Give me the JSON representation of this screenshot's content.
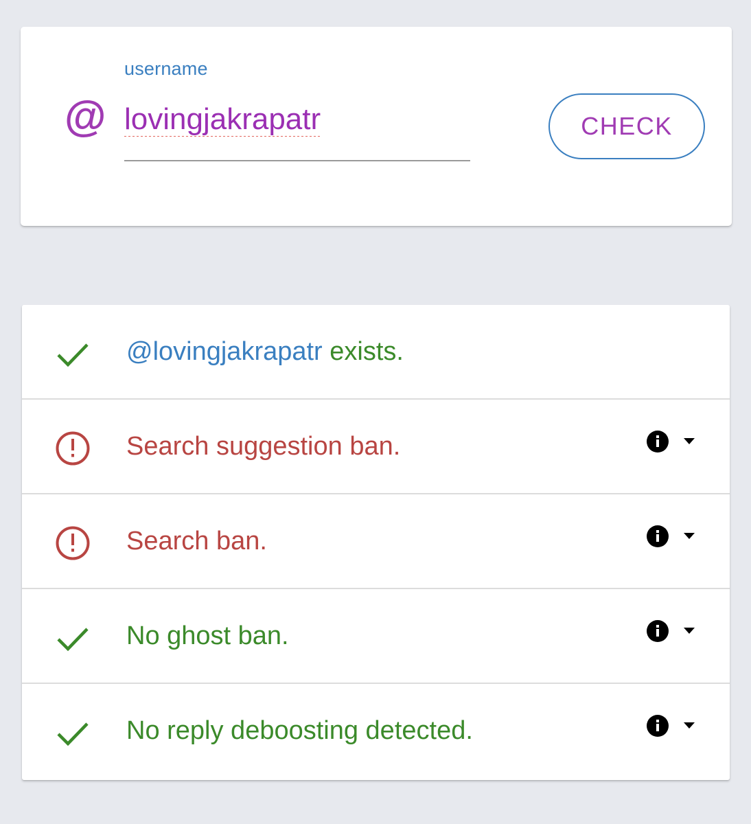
{
  "form": {
    "field_label": "username",
    "at_symbol": "@",
    "username_value": "lovingjakrapatr",
    "check_label": "CHECK"
  },
  "results": [
    {
      "status": "ok",
      "icon": "check-icon",
      "handle": "@lovingjakrapatr",
      "text": " exists.",
      "has_details": false
    },
    {
      "status": "ban",
      "icon": "alert-circle-icon",
      "text": "Search suggestion ban.",
      "has_details": true
    },
    {
      "status": "ban",
      "icon": "alert-circle-icon",
      "text": "Search ban.",
      "has_details": true
    },
    {
      "status": "ok",
      "icon": "check-icon",
      "text": "No ghost ban.",
      "has_details": true
    },
    {
      "status": "ok",
      "icon": "check-icon",
      "text": "No reply deboosting detected.",
      "has_details": true
    }
  ],
  "colors": {
    "background": "#e7e9ee",
    "accent_purple": "#a03bb3",
    "accent_blue": "#3a7fc0",
    "ok_green": "#3b8a2a",
    "ban_red": "#b84542"
  }
}
